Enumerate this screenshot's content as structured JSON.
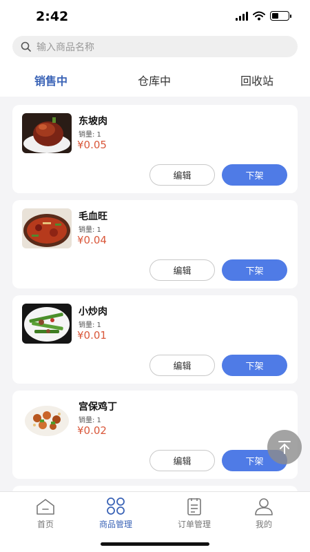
{
  "status_bar": {
    "time": "2:42"
  },
  "search": {
    "placeholder": "输入商品名称"
  },
  "tabs": [
    {
      "label": "销售中",
      "active": true
    },
    {
      "label": "仓库中",
      "active": false
    },
    {
      "label": "回收站",
      "active": false
    }
  ],
  "products": [
    {
      "name": "东坡肉",
      "sales": "销量: 1",
      "price": "¥0.05",
      "edit_label": "编辑",
      "offshelf_label": "下架"
    },
    {
      "name": "毛血旺",
      "sales": "销量: 1",
      "price": "¥0.04",
      "edit_label": "编辑",
      "offshelf_label": "下架"
    },
    {
      "name": "小炒肉",
      "sales": "销量: 1",
      "price": "¥0.01",
      "edit_label": "编辑",
      "offshelf_label": "下架"
    },
    {
      "name": "宫保鸡丁",
      "sales": "销量: 1",
      "price": "¥0.02",
      "edit_label": "编辑",
      "offshelf_label": "下架"
    }
  ],
  "bottom_nav": [
    {
      "label": "首页",
      "icon": "home-icon",
      "active": false
    },
    {
      "label": "商品管理",
      "icon": "grid-icon",
      "active": true
    },
    {
      "label": "订单管理",
      "icon": "clipboard-icon",
      "active": false
    },
    {
      "label": "我的",
      "icon": "user-icon",
      "active": false
    }
  ],
  "colors": {
    "accent": "#3a63b6",
    "button": "#4f7be6",
    "price": "#d9573a"
  }
}
